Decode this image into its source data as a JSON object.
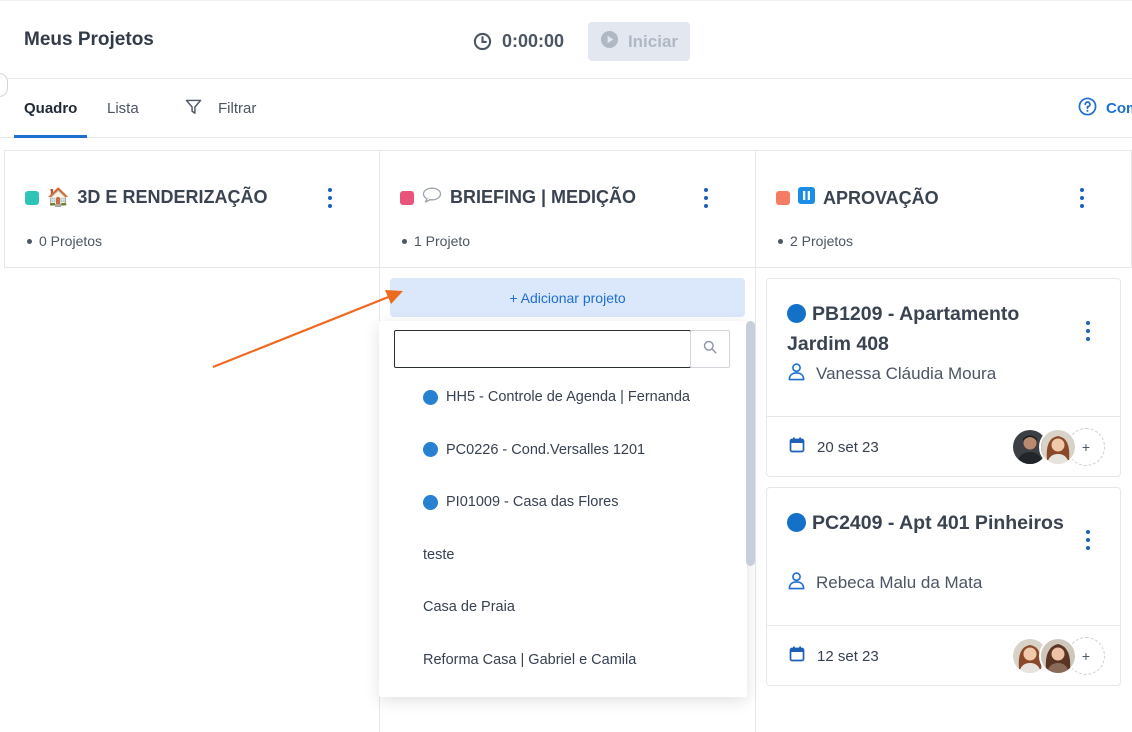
{
  "header": {
    "title": "Meus Projetos",
    "timer": "0:00:00",
    "start_label": "Iniciar"
  },
  "tabs": {
    "quadro": "Quadro",
    "lista": "Lista",
    "filter": "Filtrar",
    "help": "Com"
  },
  "columns": [
    {
      "title": "3D E RENDERIZAÇÃO",
      "icon": "🏠",
      "count": "0 Projetos",
      "color": "#2ec4b6"
    },
    {
      "title": "BRIEFING | MEDIÇÃO",
      "icon": "💬",
      "count": "1 Projeto",
      "color": "#e8557a"
    },
    {
      "title": "APROVAÇÃO",
      "icon": "⏸",
      "count": "2 Projetos",
      "color": "#f37c62"
    }
  ],
  "add_project_label": "+ Adicionar projeto",
  "dropdown": {
    "search_value": "",
    "items": [
      {
        "label": "HH5 - Controle de Agenda | Fernanda",
        "dot": true
      },
      {
        "label": "PC0226 - Cond.Versalles 1201",
        "dot": true
      },
      {
        "label": "PI01009 - Casa das Flores",
        "dot": true
      },
      {
        "label": "teste",
        "dot": false
      },
      {
        "label": "Casa de Praia",
        "dot": false
      },
      {
        "label": "Reforma Casa | Gabriel e Camila",
        "dot": false
      }
    ]
  },
  "cards": [
    {
      "title": "PB1209 - Apartamento Jardim 408",
      "user": "Vanessa Cláudia Moura",
      "date": "20 set 23"
    },
    {
      "title": "PC2409 - Apt 401 Pinheiros",
      "user": "Rebeca Malu da Mata",
      "date": "12 set 23"
    }
  ],
  "colors": {
    "accent": "#1e6fd0",
    "add_button_bg": "#dbe7fb",
    "arrow": "#ee6a1f"
  }
}
